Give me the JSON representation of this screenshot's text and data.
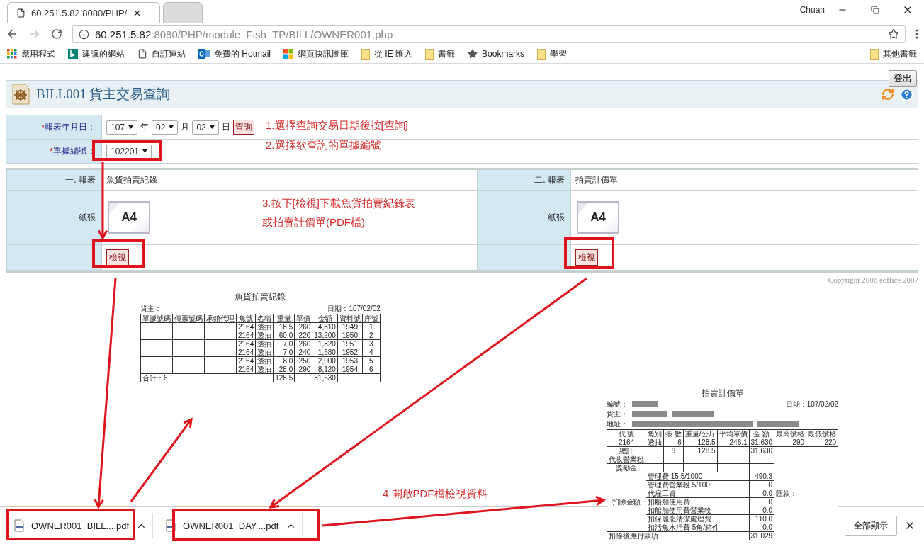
{
  "browser": {
    "tabs": [
      {
        "title": "60.251.5.82:8080/PHP/",
        "selected": true
      },
      {
        "selected": false
      }
    ],
    "profile": "Chuan",
    "url": {
      "host": "60.251.5.82",
      "path": ":8080/PHP/module_Fish_TP/BILL/OWNER001.php"
    },
    "bookmarks": [
      {
        "kind": "apps",
        "label": "應用程式"
      },
      {
        "kind": "bing",
        "label": "建議的網站"
      },
      {
        "kind": "page",
        "label": "自訂連結"
      },
      {
        "kind": "outlook",
        "label": "免費的 Hotmail"
      },
      {
        "kind": "windows",
        "label": "網頁快訊圖庫"
      },
      {
        "kind": "folder",
        "label": "從 IE 匯入"
      },
      {
        "kind": "folder",
        "label": "書籤"
      },
      {
        "kind": "star",
        "label": "Bookmarks"
      },
      {
        "kind": "folder",
        "label": "學習"
      }
    ],
    "other_bookmarks": "其他書籤"
  },
  "page": {
    "logout": "登出",
    "title": "BILL001 貨主交易查詢",
    "form": {
      "date_row": {
        "required_mark": "*",
        "label": "報表年月日：",
        "year": "107",
        "year_unit": "年",
        "month": "02",
        "month_unit": "月",
        "day": "02",
        "day_unit": "日",
        "query": "查詢"
      },
      "doc_row": {
        "required_mark": "*",
        "label": "單據編號：",
        "value": "102201"
      }
    },
    "reports": [
      {
        "label": "一. 報表",
        "name": "魚貨拍賣紀錄",
        "paper_label": "紙張",
        "paper": "A4",
        "view": "檢視"
      },
      {
        "label": "二. 報表",
        "name": "拍賣計價單",
        "paper_label": "紙張",
        "paper": "A4",
        "view": "檢視"
      }
    ],
    "copyright": "Copyright 2006 eoffice 2007"
  },
  "annotations": [
    "1.選擇查詢交易日期後按[查詢]",
    "2.選擇欲查詢的單據編號",
    "3.按下[檢視]下載魚貨拍賣紀錄表",
    "或拍賣計價單(PDF檔)",
    "4.開啟PDF檔檢視資料"
  ],
  "fish_record": {
    "title": "魚貨拍賣紀錄",
    "owner": "貨主：",
    "date": "日期：107/02/02",
    "columns": [
      "單據號碼",
      "傳票號碼",
      "承銷代理",
      "魚號",
      "名稱",
      "重量",
      "單價",
      "金額",
      "資料號",
      "序號"
    ],
    "rows": [
      [
        "",
        "",
        "",
        "2164",
        "透抽",
        "18.5",
        "260",
        "4,810",
        "1949",
        "1"
      ],
      [
        "",
        "",
        "",
        "2164",
        "透抽",
        "60.0",
        "220",
        "13,200",
        "1950",
        "2"
      ],
      [
        "",
        "",
        "",
        "2164",
        "透抽",
        "7.0",
        "260",
        "1,820",
        "1951",
        "3"
      ],
      [
        "",
        "",
        "",
        "2164",
        "透抽",
        "7.0",
        "240",
        "1,680",
        "1952",
        "4"
      ],
      [
        "",
        "",
        "",
        "2164",
        "透抽",
        "8.0",
        "250",
        "2,000",
        "1953",
        "5"
      ],
      [
        "",
        "",
        "",
        "2164",
        "透抽",
        "28.0",
        "290",
        "8,120",
        "1954",
        "6"
      ]
    ],
    "total": {
      "label": "合計：6",
      "weight": "128.5",
      "amount": "31,630"
    }
  },
  "settlement": {
    "title": "拍賣計價單",
    "info": [
      "編號：",
      "貨主：",
      "地址："
    ],
    "date": "日期：107/02/02",
    "columns": [
      "代 號",
      "魚別",
      "張 數",
      "重量/公斤",
      "平均單價",
      "金 額",
      "最高價格",
      "最低價格"
    ],
    "row": [
      "2164",
      "透抽",
      "6",
      "128.5",
      "246.1",
      "31,630",
      "290",
      "220"
    ],
    "total": {
      "label": "總計",
      "count": "6",
      "weight": "128.5",
      "amount": "31,630"
    },
    "empty_rows": [
      "代收營業稅",
      "獎勵金"
    ],
    "deduction_label": "扣除金額",
    "deductions": [
      {
        "item": "管理費 15.5/1000",
        "amount": "490.3"
      },
      {
        "item": "管理費營業稅 5/100",
        "amount": "0"
      },
      {
        "item": "代雇工資",
        "amount": "0.0"
      },
      {
        "item": "扣船舶使用費",
        "amount": "0"
      },
      {
        "item": "扣船舶使用費營業稅",
        "amount": "0.0"
      },
      {
        "item": "扣保麗龍清潔處理費",
        "amount": "110.0"
      },
      {
        "item": "扣活魚水污費 5角/箱件",
        "amount": "0.0"
      }
    ],
    "remittance": "匯款：",
    "final": {
      "label": "扣除後應付款項",
      "amount": "31,029"
    }
  },
  "downloads": {
    "files": [
      "OWNER001_BILL....pdf",
      "OWNER001_DAY....pdf"
    ],
    "show_all": "全部顯示"
  }
}
